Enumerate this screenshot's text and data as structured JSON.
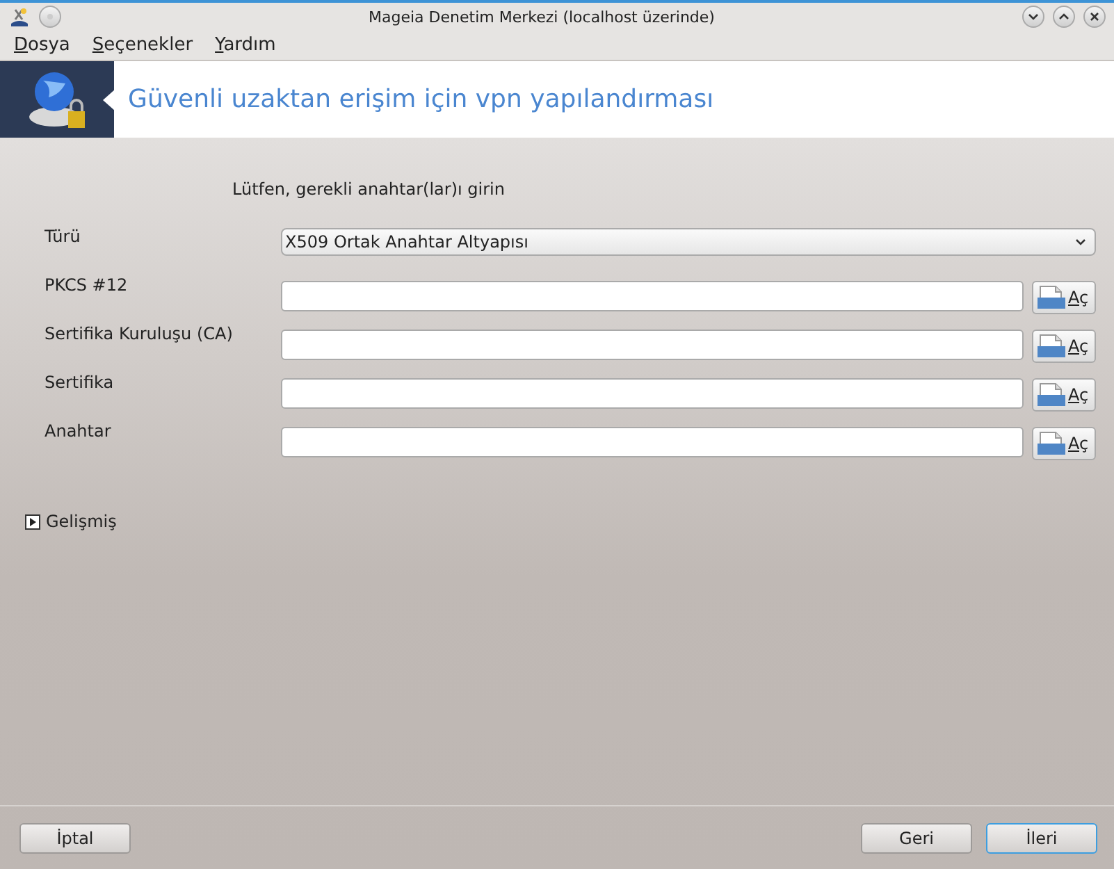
{
  "window": {
    "title": "Mageia Denetim Merkezi  (localhost üzerinde)"
  },
  "menu": [
    "Dosya",
    "Seçenekler",
    "Yardım"
  ],
  "header": {
    "title": "Güvenli uzaktan erişim için vpn yapılandırması"
  },
  "prompt": "Lütfen, gerekli anahtar(lar)ı girin",
  "fields": [
    {
      "kind": "combo",
      "label": "Türü",
      "value": "X509 Ortak Anahtar Altyapısı"
    },
    {
      "kind": "file",
      "label": "PKCS #12",
      "button": "Aç"
    },
    {
      "kind": "file",
      "label": "Sertifika Kuruluşu (CA)",
      "button": "Aç"
    },
    {
      "kind": "file",
      "label": "Sertifika",
      "button": "Aç"
    },
    {
      "kind": "file",
      "label": "Anahtar",
      "button": "Aç"
    }
  ],
  "advanced": {
    "label": "Gelişmiş",
    "expanded": false
  },
  "buttons": [
    {
      "label": "İptal",
      "focused": false
    },
    {
      "label": "Geri",
      "focused": false
    },
    {
      "label": "İleri",
      "focused": true
    }
  ]
}
